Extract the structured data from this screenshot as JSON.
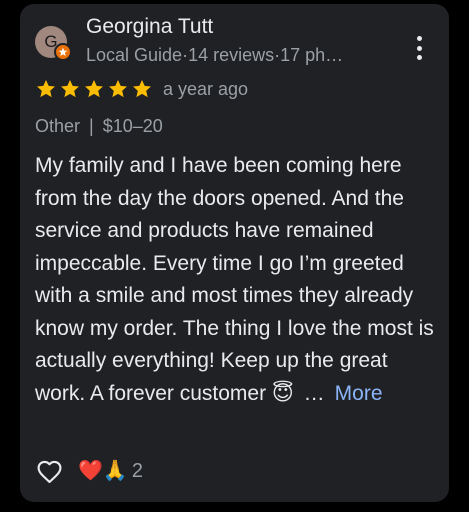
{
  "review": {
    "reviewer": {
      "name": "Georgina Tutt",
      "avatar_initial": "G",
      "avatar_color": "#a1887f",
      "badge_color": "#e8710a",
      "badge_icon": "local-guide-star-icon",
      "meta": {
        "role": "Local Guide",
        "reviews": "14 reviews",
        "photos": "17 ph…",
        "separator": "·"
      }
    },
    "rating": {
      "value": 5,
      "max": 5,
      "star_color": "#fbbc04"
    },
    "date": "a year ago",
    "attributes": {
      "category": "Other",
      "separator": "|",
      "price": "$10–20"
    },
    "text": "My family and I have been coming here from the day the doors opened. And the service and products have remained impeccable. Every time I go I’m greeted with a smile and most times they already know my order. The thing I love the most is actually everything! Keep up the great work. A forever customer 😇",
    "ellipsis": "…",
    "more_label": "More",
    "more_color": "#8ab4f8",
    "reactions": {
      "emojis": "❤️🙏",
      "count": "2"
    },
    "icons": {
      "menu": "more-vert-icon",
      "like": "heart-outline-icon"
    }
  }
}
